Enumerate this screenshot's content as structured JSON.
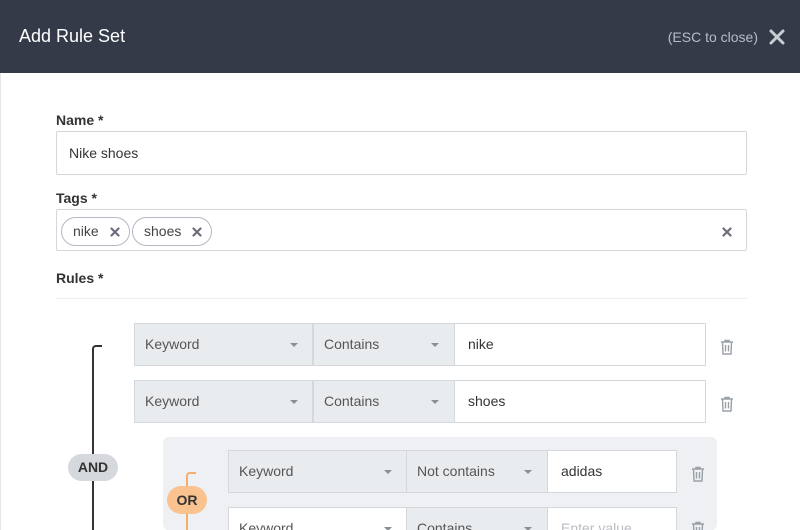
{
  "header": {
    "title": "Add Rule Set",
    "esc_hint": "(ESC to close)",
    "close_icon": "close-icon"
  },
  "form": {
    "name_label": "Name *",
    "name_value": "Nike shoes",
    "tags_label": "Tags *",
    "tags": [
      "nike",
      "shoes"
    ],
    "rules_label": "Rules *"
  },
  "rules": {
    "root_operator": "AND",
    "rows": [
      {
        "field": "Keyword",
        "operator": "Contains",
        "value": "nike"
      },
      {
        "field": "Keyword",
        "operator": "Contains",
        "value": "shoes"
      }
    ],
    "group": {
      "operator": "OR",
      "rows": [
        {
          "field": "Keyword",
          "operator": "Not contains",
          "value": "adidas"
        },
        {
          "field": "Keyword",
          "operator": "Contains",
          "value": "",
          "placeholder": "Enter value"
        }
      ]
    }
  },
  "colors": {
    "header_bg": "#343a48",
    "or_accent": "#f9c28f",
    "and_pill": "#d5d8dd",
    "group_bg": "#eef0f3"
  }
}
